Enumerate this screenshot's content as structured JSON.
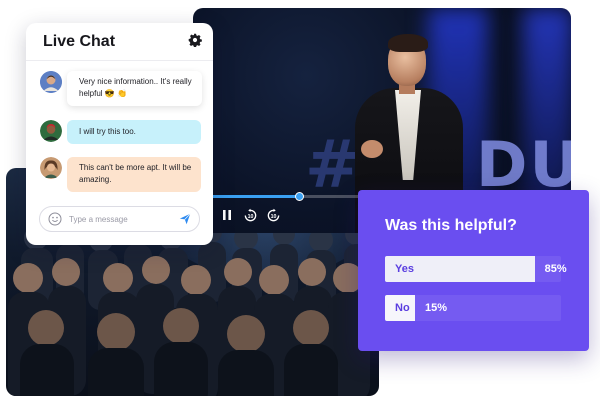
{
  "chat": {
    "title": "Live Chat",
    "messages": [
      {
        "text": "Very nice information.. It's really helpful 😎 👏",
        "bubble_color": "#ffffff"
      },
      {
        "text": "I will try this too.",
        "bubble_color": "#c7f1fb"
      },
      {
        "text": "This can't be more apt. It will be amazing.",
        "bubble_color": "#fde3cd"
      }
    ],
    "input": {
      "placeholder": "Type a message",
      "value": ""
    },
    "icons": [
      "gear-icon",
      "smile-icon",
      "send-icon"
    ]
  },
  "video": {
    "progress_fraction": 0.28,
    "accent_color": "#3aa0f2",
    "controls": [
      "pause-icon",
      "rewind-10-icon",
      "forward-10-icon"
    ]
  },
  "poll": {
    "question": "Was this helpful?",
    "background_color": "#6a4ef0",
    "options": [
      {
        "label": "Yes",
        "percent_text": "85%",
        "value": 0.85
      },
      {
        "label": "No",
        "percent_text": "15%",
        "value": 0.15
      }
    ]
  }
}
